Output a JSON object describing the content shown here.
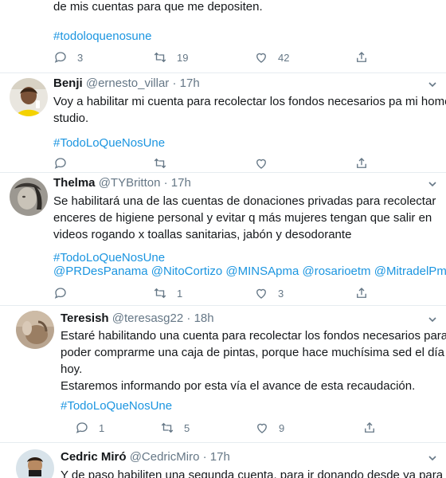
{
  "colors": {
    "link": "#1b95e0",
    "muted": "#657786",
    "text": "#14171a",
    "divider": "#e6ecf0"
  },
  "icons": {
    "reply": "reply-icon",
    "retweet": "retweet-icon",
    "like": "heart-icon",
    "share": "share-icon",
    "more": "chevron-down-icon"
  },
  "top_tweet": {
    "text_line": "de mis cuentas para que me depositen.",
    "hashtag": "#todoloquenosune",
    "replies": "3",
    "retweets": "19",
    "likes": "42"
  },
  "tweets": [
    {
      "name": "Benji",
      "handle": "@ernesto_villar",
      "sep": "·",
      "time": "17h",
      "lines": [
        "Voy a habilitar mi cuenta para recolectar los fondos necesarios pa mi home",
        "studio."
      ],
      "hashtag": "#TodoLoQueNosUne",
      "replies": "",
      "retweets": "",
      "likes": ""
    },
    {
      "name": "Thelma",
      "handle": "@TYBritton",
      "sep": "·",
      "time": "17h",
      "lines": [
        "Se habilitará una de las cuentas de donaciones privadas para recolectar",
        "enceres de higiene personal y evitar q más mujeres tengan que salir en",
        "videos rogando x toallas sanitarias, jabón y desodorante"
      ],
      "hashtag": "#TodoLoQueNosUne",
      "mentions": [
        "@PRDesPanama",
        "@NitoCortizo",
        "@MINSApma",
        "@rosarioetm",
        "@MitradelPma"
      ],
      "replies": "",
      "retweets": "1",
      "likes": "3"
    },
    {
      "name": "Teresish",
      "handle": "@teresasg22",
      "sep": "·",
      "time": "18h",
      "lines": [
        "Estaré habilitando una cuenta para recolectar los fondos necesarios para",
        "poder comprarme una caja de pintas, porque hace muchísima sed el día de",
        "hoy.",
        "Estaremos informando por esta vía el avance de esta recaudación."
      ],
      "hashtag": "#TodoLoQueNosUne",
      "replies": "1",
      "retweets": "5",
      "likes": "9"
    },
    {
      "name": "Cedric Miró",
      "handle": "@CedricMiro",
      "sep": "·",
      "time": "17h",
      "lines": [
        "Y de paso habiliten una segunda cuenta, para ir donando desde ya para la"
      ]
    }
  ]
}
